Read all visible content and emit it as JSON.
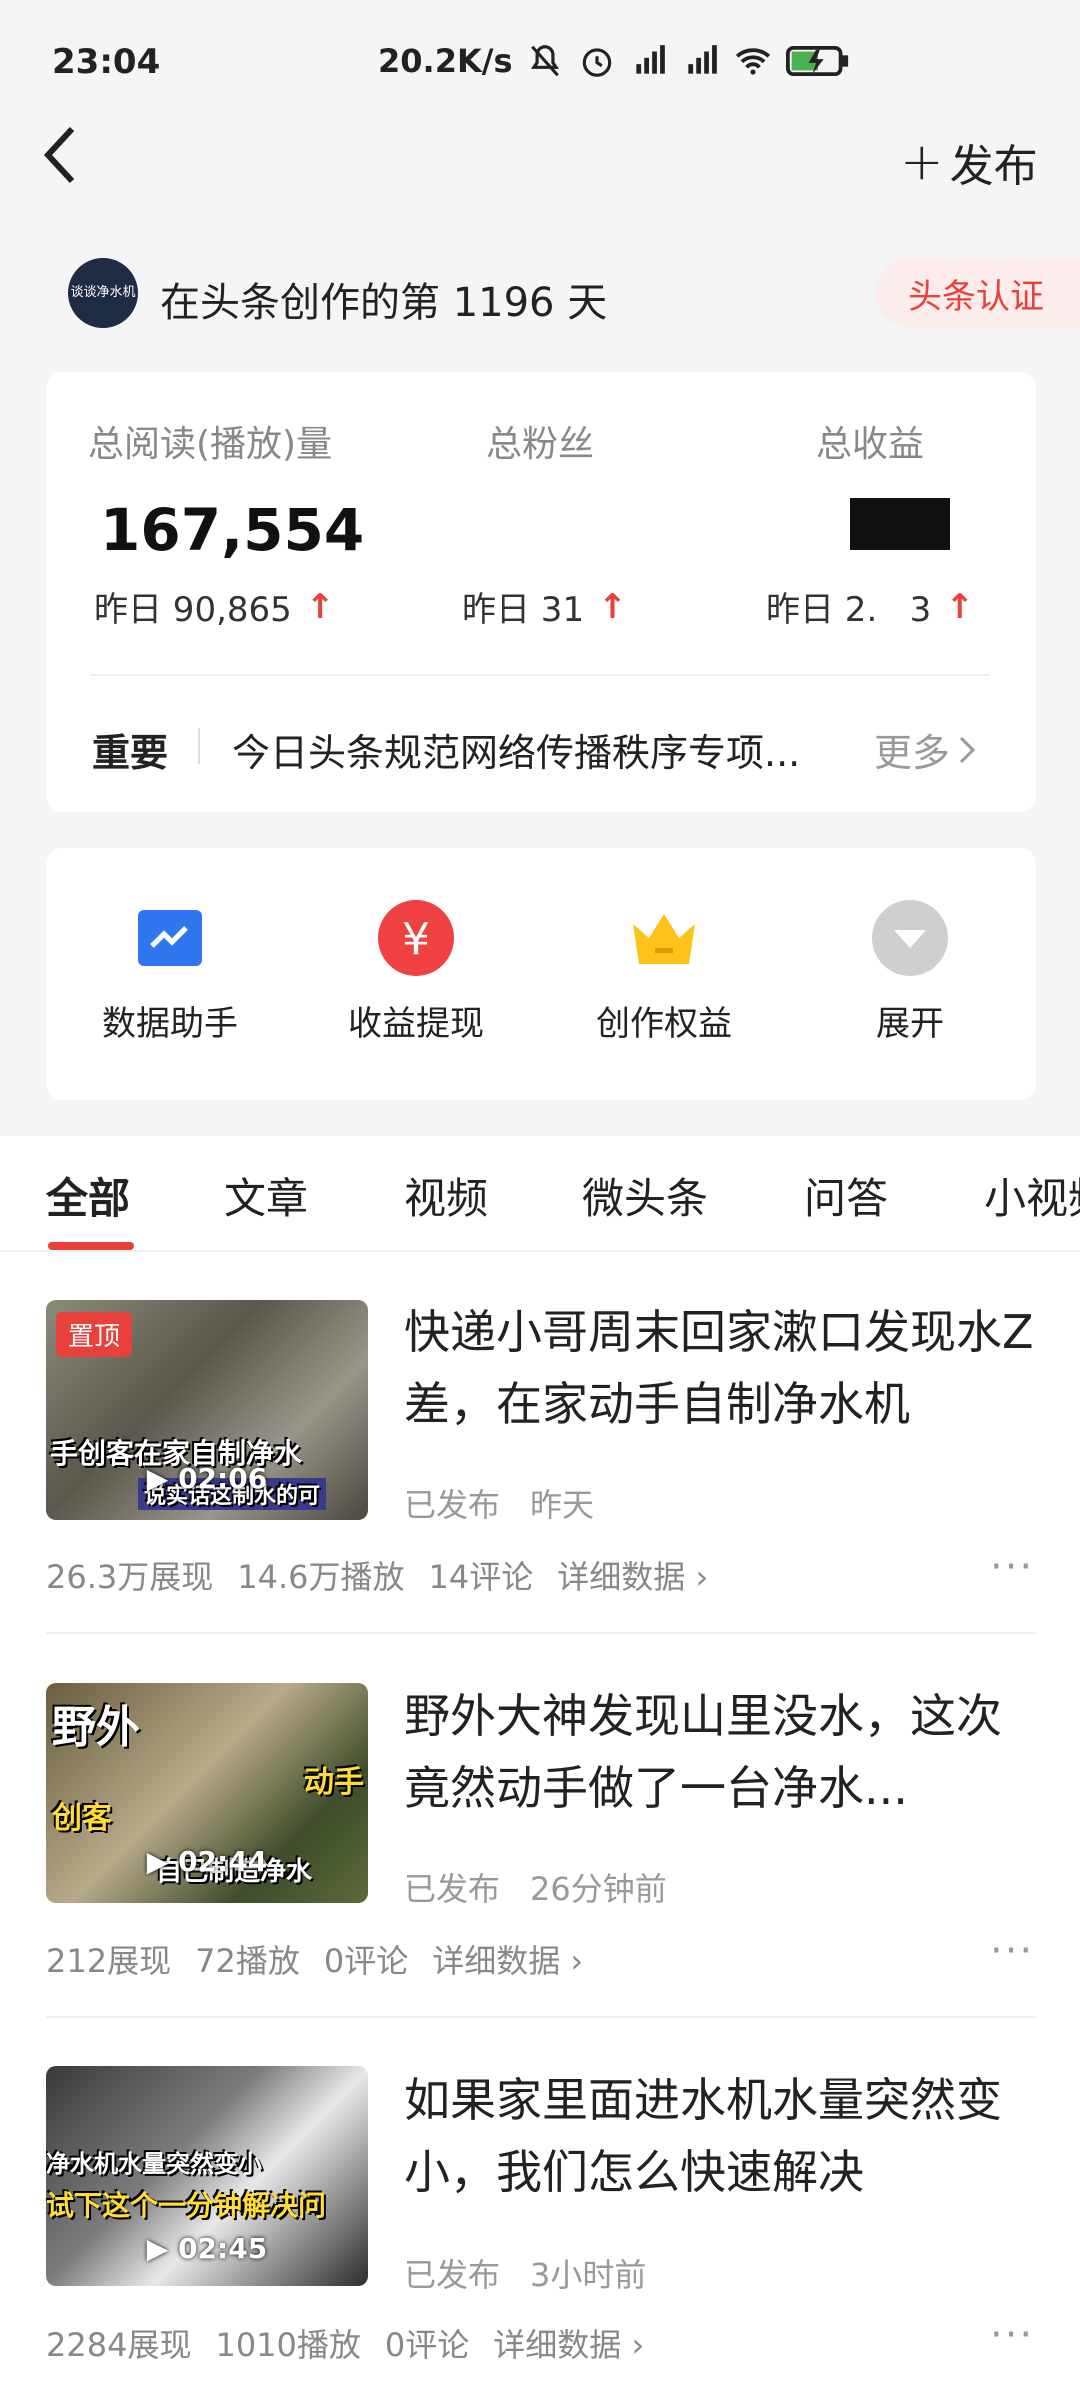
{
  "status_bar": {
    "time": "23:04",
    "net_speed": "20.2K/s"
  },
  "nav": {
    "publish_label": "发布"
  },
  "creator": {
    "avatar_text": "谈谈净水机",
    "days_text": "在头条创作的第 1196 天",
    "cert_label": "头条认证"
  },
  "stats": {
    "reads_label": "总阅读(播放)量",
    "fans_label": "总粉丝",
    "income_label": "总收益",
    "reads_value": "167,554",
    "reads_yesterday": "昨日 90,865",
    "fans_yesterday": "昨日 31",
    "income_yesterday": "昨日 2.   3"
  },
  "notice": {
    "key": "重要",
    "text": "今日头条规范网络传播秩序专项...",
    "more_label": "更多"
  },
  "tools": [
    {
      "label": "数据助手",
      "icon": "chart-icon"
    },
    {
      "label": "收益提现",
      "icon": "yuan-icon"
    },
    {
      "label": "创作权益",
      "icon": "crown-icon"
    },
    {
      "label": "展开",
      "icon": "expand-icon"
    }
  ],
  "tabs": [
    "全部",
    "文章",
    "视频",
    "微头条",
    "问答",
    "小视频"
  ],
  "items": [
    {
      "title": "快递小哥周末回家漱口发现水Z差，在家动手自制净水机",
      "pinned": "置顶",
      "duration": "02:06",
      "status": "已发布",
      "time": "昨天",
      "impressions": "26.3万展现",
      "plays": "14.6万播放",
      "comments": "14评论",
      "detail": "详细数据",
      "thumb_text": [
        "手创客在家自制净水",
        "说实话这制水的可"
      ]
    },
    {
      "title": "野外大神发现山里没水，这次竟然动手做了一台净水...",
      "duration": "02:44",
      "status": "已发布",
      "time": "26分钟前",
      "impressions": "212展现",
      "plays": "72播放",
      "comments": "0评论",
      "detail": "详细数据",
      "thumb_text": [
        "野外",
        "创客",
        "动手",
        "自己制造净水"
      ]
    },
    {
      "title": "如果家里面进水机水量突然变小，我们怎么快速解决",
      "duration": "02:45",
      "status": "已发布",
      "time": "3小时前",
      "impressions": "2284展现",
      "plays": "1010播放",
      "comments": "0评论",
      "detail": "详细数据",
      "thumb_text": [
        "净水机水量突然变小",
        "试下这个一分钟解决问"
      ]
    }
  ]
}
